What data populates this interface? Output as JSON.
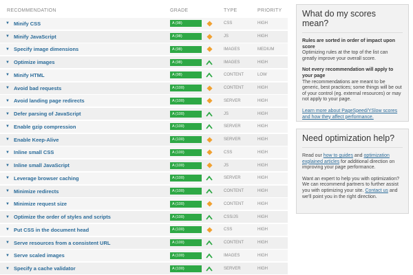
{
  "table": {
    "headers": {
      "name": "RECOMMENDATION",
      "grade": "GRADE",
      "type": "TYPE",
      "priority": "PRIORITY"
    },
    "rows": [
      {
        "name": "Minify CSS",
        "grade": "A (98)",
        "grade_value": 98,
        "trend": "diamond",
        "type": "CSS",
        "priority": "HIGH"
      },
      {
        "name": "Minify JavaScript",
        "grade": "A (98)",
        "grade_value": 98,
        "trend": "diamond",
        "type": "JS",
        "priority": "HIGH"
      },
      {
        "name": "Specify image dimensions",
        "grade": "A (98)",
        "grade_value": 98,
        "trend": "diamond",
        "type": "IMAGES",
        "priority": "MEDIUM"
      },
      {
        "name": "Optimize images",
        "grade": "A (98)",
        "grade_value": 98,
        "trend": "up",
        "type": "IMAGES",
        "priority": "HIGH"
      },
      {
        "name": "Minify HTML",
        "grade": "A (98)",
        "grade_value": 98,
        "trend": "up",
        "type": "CONTENT",
        "priority": "LOW"
      },
      {
        "name": "Avoid bad requests",
        "grade": "A (100)",
        "grade_value": 100,
        "trend": "diamond",
        "type": "CONTENT",
        "priority": "HIGH"
      },
      {
        "name": "Avoid landing page redirects",
        "grade": "A (100)",
        "grade_value": 100,
        "trend": "diamond",
        "type": "SERVER",
        "priority": "HIGH"
      },
      {
        "name": "Defer parsing of JavaScript",
        "grade": "A (100)",
        "grade_value": 100,
        "trend": "up",
        "type": "JS",
        "priority": "HIGH"
      },
      {
        "name": "Enable gzip compression",
        "grade": "A (100)",
        "grade_value": 100,
        "trend": "up",
        "type": "SERVER",
        "priority": "HIGH"
      },
      {
        "name": "Enable Keep-Alive",
        "grade": "A (100)",
        "grade_value": 100,
        "trend": "diamond",
        "type": "SERVER",
        "priority": "HIGH"
      },
      {
        "name": "Inline small CSS",
        "grade": "A (100)",
        "grade_value": 100,
        "trend": "diamond",
        "type": "CSS",
        "priority": "HIGH"
      },
      {
        "name": "Inline small JavaScript",
        "grade": "A (100)",
        "grade_value": 100,
        "trend": "diamond",
        "type": "JS",
        "priority": "HIGH"
      },
      {
        "name": "Leverage browser caching",
        "grade": "A (100)",
        "grade_value": 100,
        "trend": "up",
        "type": "SERVER",
        "priority": "HIGH"
      },
      {
        "name": "Minimize redirects",
        "grade": "A (100)",
        "grade_value": 100,
        "trend": "up",
        "type": "CONTENT",
        "priority": "HIGH"
      },
      {
        "name": "Minimize request size",
        "grade": "A (100)",
        "grade_value": 100,
        "trend": "diamond",
        "type": "CONTENT",
        "priority": "HIGH"
      },
      {
        "name": "Optimize the order of styles and scripts",
        "grade": "A (100)",
        "grade_value": 100,
        "trend": "up",
        "type": "CSS/JS",
        "priority": "HIGH"
      },
      {
        "name": "Put CSS in the document head",
        "grade": "A (100)",
        "grade_value": 100,
        "trend": "diamond",
        "type": "CSS",
        "priority": "HIGH"
      },
      {
        "name": "Serve resources from a consistent URL",
        "grade": "A (100)",
        "grade_value": 100,
        "trend": "up",
        "type": "CONTENT",
        "priority": "HIGH"
      },
      {
        "name": "Serve scaled images",
        "grade": "A (100)",
        "grade_value": 100,
        "trend": "up",
        "type": "IMAGES",
        "priority": "HIGH"
      },
      {
        "name": "Specify a cache validator",
        "grade": "A (100)",
        "grade_value": 100,
        "trend": "up",
        "type": "SERVER",
        "priority": "HIGH"
      }
    ]
  },
  "colors": {
    "grade_bar": "#2ea845",
    "trend_up": "#2ea845",
    "trend_diamond": "#f0a030",
    "link": "#2a6b99"
  },
  "scores_panel": {
    "title": "What do my scores mean?",
    "h1": "Rules are sorted in order of impact upon score",
    "p1": "Optimizing rules at the top of the list can greatly improve your overall score.",
    "h2": "Not every recommendation will apply to your page",
    "p2": "The recommendations are meant to be generic, best practices; some things will be out of your control (eg. external resources) or may not apply to your page.",
    "link": "Learn more about PageSpeed/YSlow scores and how they affect performance."
  },
  "help_panel": {
    "title": "Need optimization help?",
    "p1_a": "Read our ",
    "p1_link1": "how to guides",
    "p1_b": " and ",
    "p1_link2": "optimization explained articles",
    "p1_c": " for additional direction on improving your page performance.",
    "p2_a": "Want an expert to help you with optimization? We can recommend partners to further assist you with optimizing your site. ",
    "p2_link": "Contact us",
    "p2_b": " and we'll point you in the right direction."
  }
}
